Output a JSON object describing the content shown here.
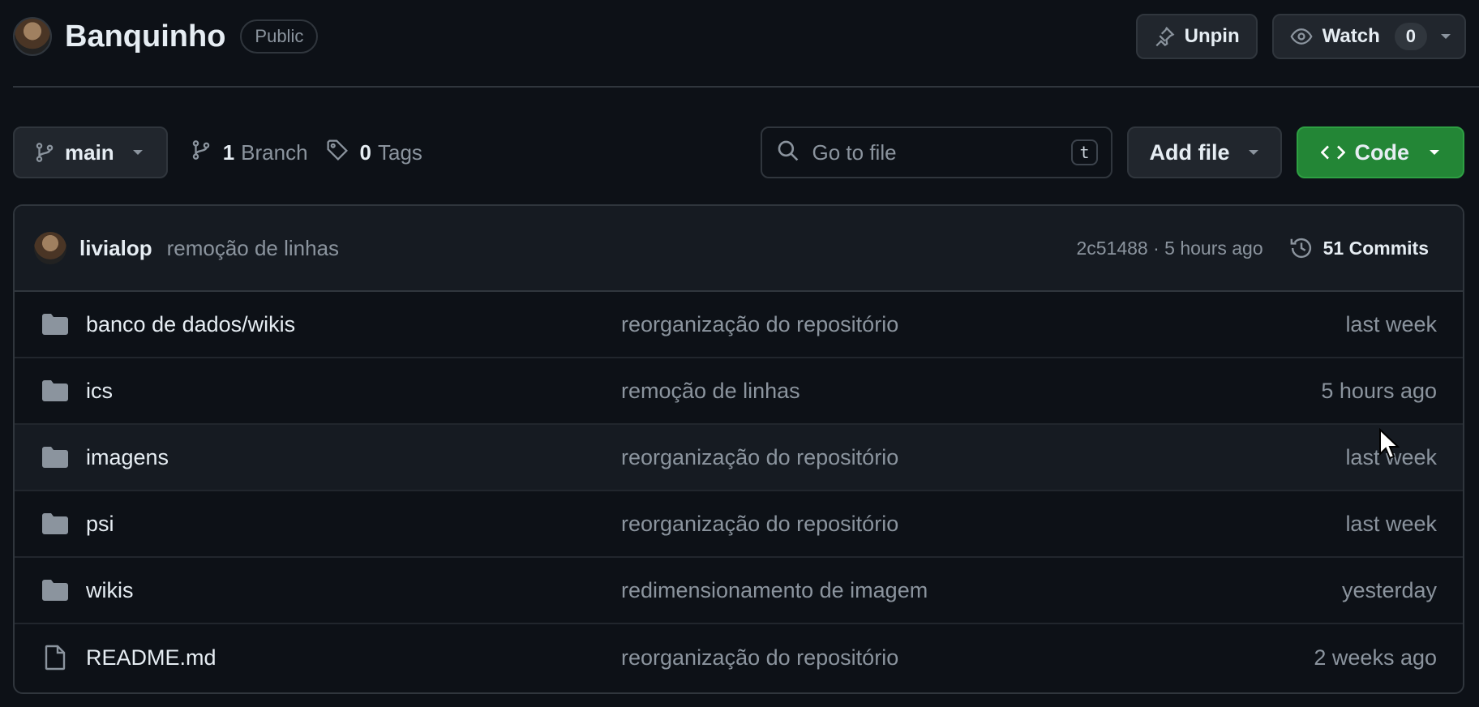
{
  "repo": {
    "name": "Banquinho",
    "visibility": "Public"
  },
  "header_actions": {
    "unpin_label": "Unpin",
    "watch_label": "Watch",
    "watch_count": "0"
  },
  "toolbar": {
    "branch": "main",
    "branch_count": "1",
    "branch_label": "Branch",
    "tag_count": "0",
    "tag_label": "Tags",
    "search_placeholder": "Go to file",
    "search_shortcut": "t",
    "add_file_label": "Add file",
    "code_label": "Code"
  },
  "latest_commit": {
    "author": "livialop",
    "message": "remoção de linhas",
    "hash_time": "2c51488 · 5 hours ago",
    "commits_label": "51 Commits"
  },
  "files": [
    {
      "type": "folder",
      "name": "banco de dados/wikis",
      "message": "reorganização do repositório",
      "date": "last week"
    },
    {
      "type": "folder",
      "name": "ics",
      "message": "remoção de linhas",
      "date": "5 hours ago"
    },
    {
      "type": "folder",
      "name": "imagens",
      "message": "reorganização do repositório",
      "date": "last week"
    },
    {
      "type": "folder",
      "name": "psi",
      "message": "reorganização do repositório",
      "date": "last week"
    },
    {
      "type": "folder",
      "name": "wikis",
      "message": "redimensionamento de imagem",
      "date": "yesterday"
    },
    {
      "type": "file",
      "name": "README.md",
      "message": "reorganização do repositório",
      "date": "2 weeks ago"
    }
  ],
  "colors": {
    "background": "#0d1117",
    "border": "#30363d",
    "muted": "#8b949e",
    "code_button": "#238636"
  }
}
